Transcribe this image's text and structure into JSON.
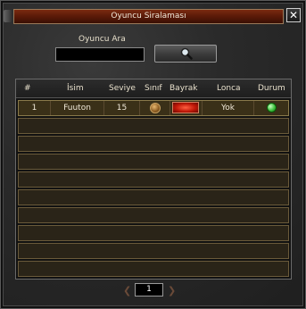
{
  "window": {
    "title": "Oyuncu Siralaması",
    "close_symbol": "✕"
  },
  "search": {
    "label": "Oyuncu Ara",
    "value": "",
    "button_icon": "magnifier-icon"
  },
  "table": {
    "headers": [
      "#",
      "İsim",
      "Seviye",
      "Sınıf",
      "Bayrak",
      "Lonca",
      "Durum"
    ],
    "rows": [
      {
        "rank": "1",
        "name": "Fuuton",
        "level": "15",
        "class_icon": "class-emblem-icon",
        "flag_icon": "red-flag-icon",
        "guild": "Yok",
        "status": "online-status-icon"
      }
    ],
    "empty_row_count": 9
  },
  "pager": {
    "page": "1",
    "prev_symbol": "❮",
    "next_symbol": "❯"
  },
  "colors": {
    "title_bar": "#6a2008",
    "row_bg": "#2a2418",
    "status_online": "#40c040"
  }
}
